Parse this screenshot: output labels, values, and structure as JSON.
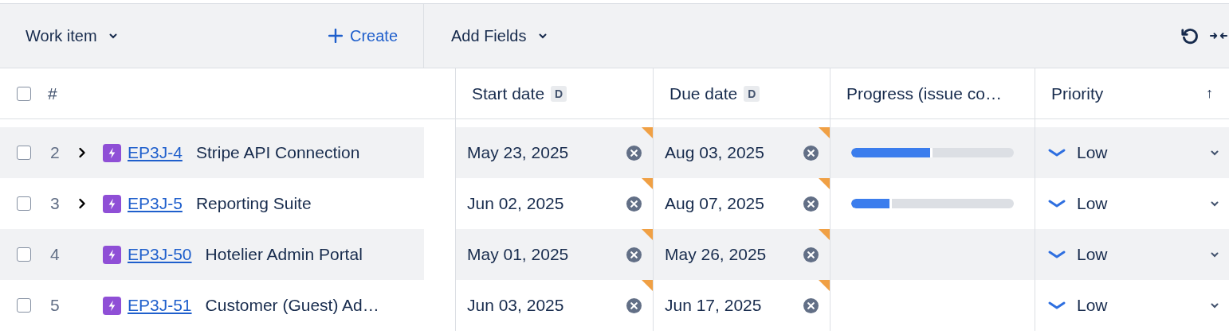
{
  "toolbar": {
    "work_item_menu": "Work item",
    "create_button": "Create",
    "add_fields_menu": "Add Fields"
  },
  "columns": [
    {
      "kind": "select",
      "label": "#",
      "checked": false
    },
    {
      "kind": "spacer"
    },
    {
      "kind": "date",
      "label": "Start date",
      "badge": "D"
    },
    {
      "kind": "date",
      "label": "Due date",
      "badge": "D"
    },
    {
      "kind": "progress",
      "label": "Progress (issue co…"
    },
    {
      "kind": "priority",
      "label": "Priority",
      "sort": "↑"
    }
  ],
  "rows": [
    {
      "number": "2",
      "checked": false,
      "expandable": true,
      "key": "EP3J-4",
      "summary": "Stripe API Connection",
      "start_date": {
        "value": "May 23, 2025",
        "flagged": true
      },
      "due_date": {
        "value": "Aug 03, 2025",
        "flagged": true
      },
      "progress": {
        "level": 0.5
      },
      "priority": "Low"
    },
    {
      "number": "3",
      "checked": false,
      "expandable": true,
      "key": "EP3J-5",
      "summary": "Reporting Suite",
      "start_date": {
        "value": "Jun 02, 2025",
        "flagged": true
      },
      "due_date": {
        "value": "Aug 07, 2025",
        "flagged": true
      },
      "progress": {
        "level": 0.25
      },
      "priority": "Low"
    },
    {
      "number": "4",
      "checked": false,
      "expandable": false,
      "key": "EP3J-50",
      "summary": "Hotelier Admin Portal",
      "start_date": {
        "value": "May 01, 2025",
        "flagged": true
      },
      "due_date": {
        "value": "May 26, 2025",
        "flagged": true
      },
      "priority": "Low"
    },
    {
      "number": "5",
      "checked": false,
      "expandable": false,
      "key": "EP3J-51",
      "summary": "Customer (Guest) Ad…",
      "start_date": {
        "value": "Jun 03, 2025",
        "flagged": true
      },
      "due_date": {
        "value": "Jun 17, 2025",
        "flagged": true
      },
      "priority": "Low"
    }
  ]
}
